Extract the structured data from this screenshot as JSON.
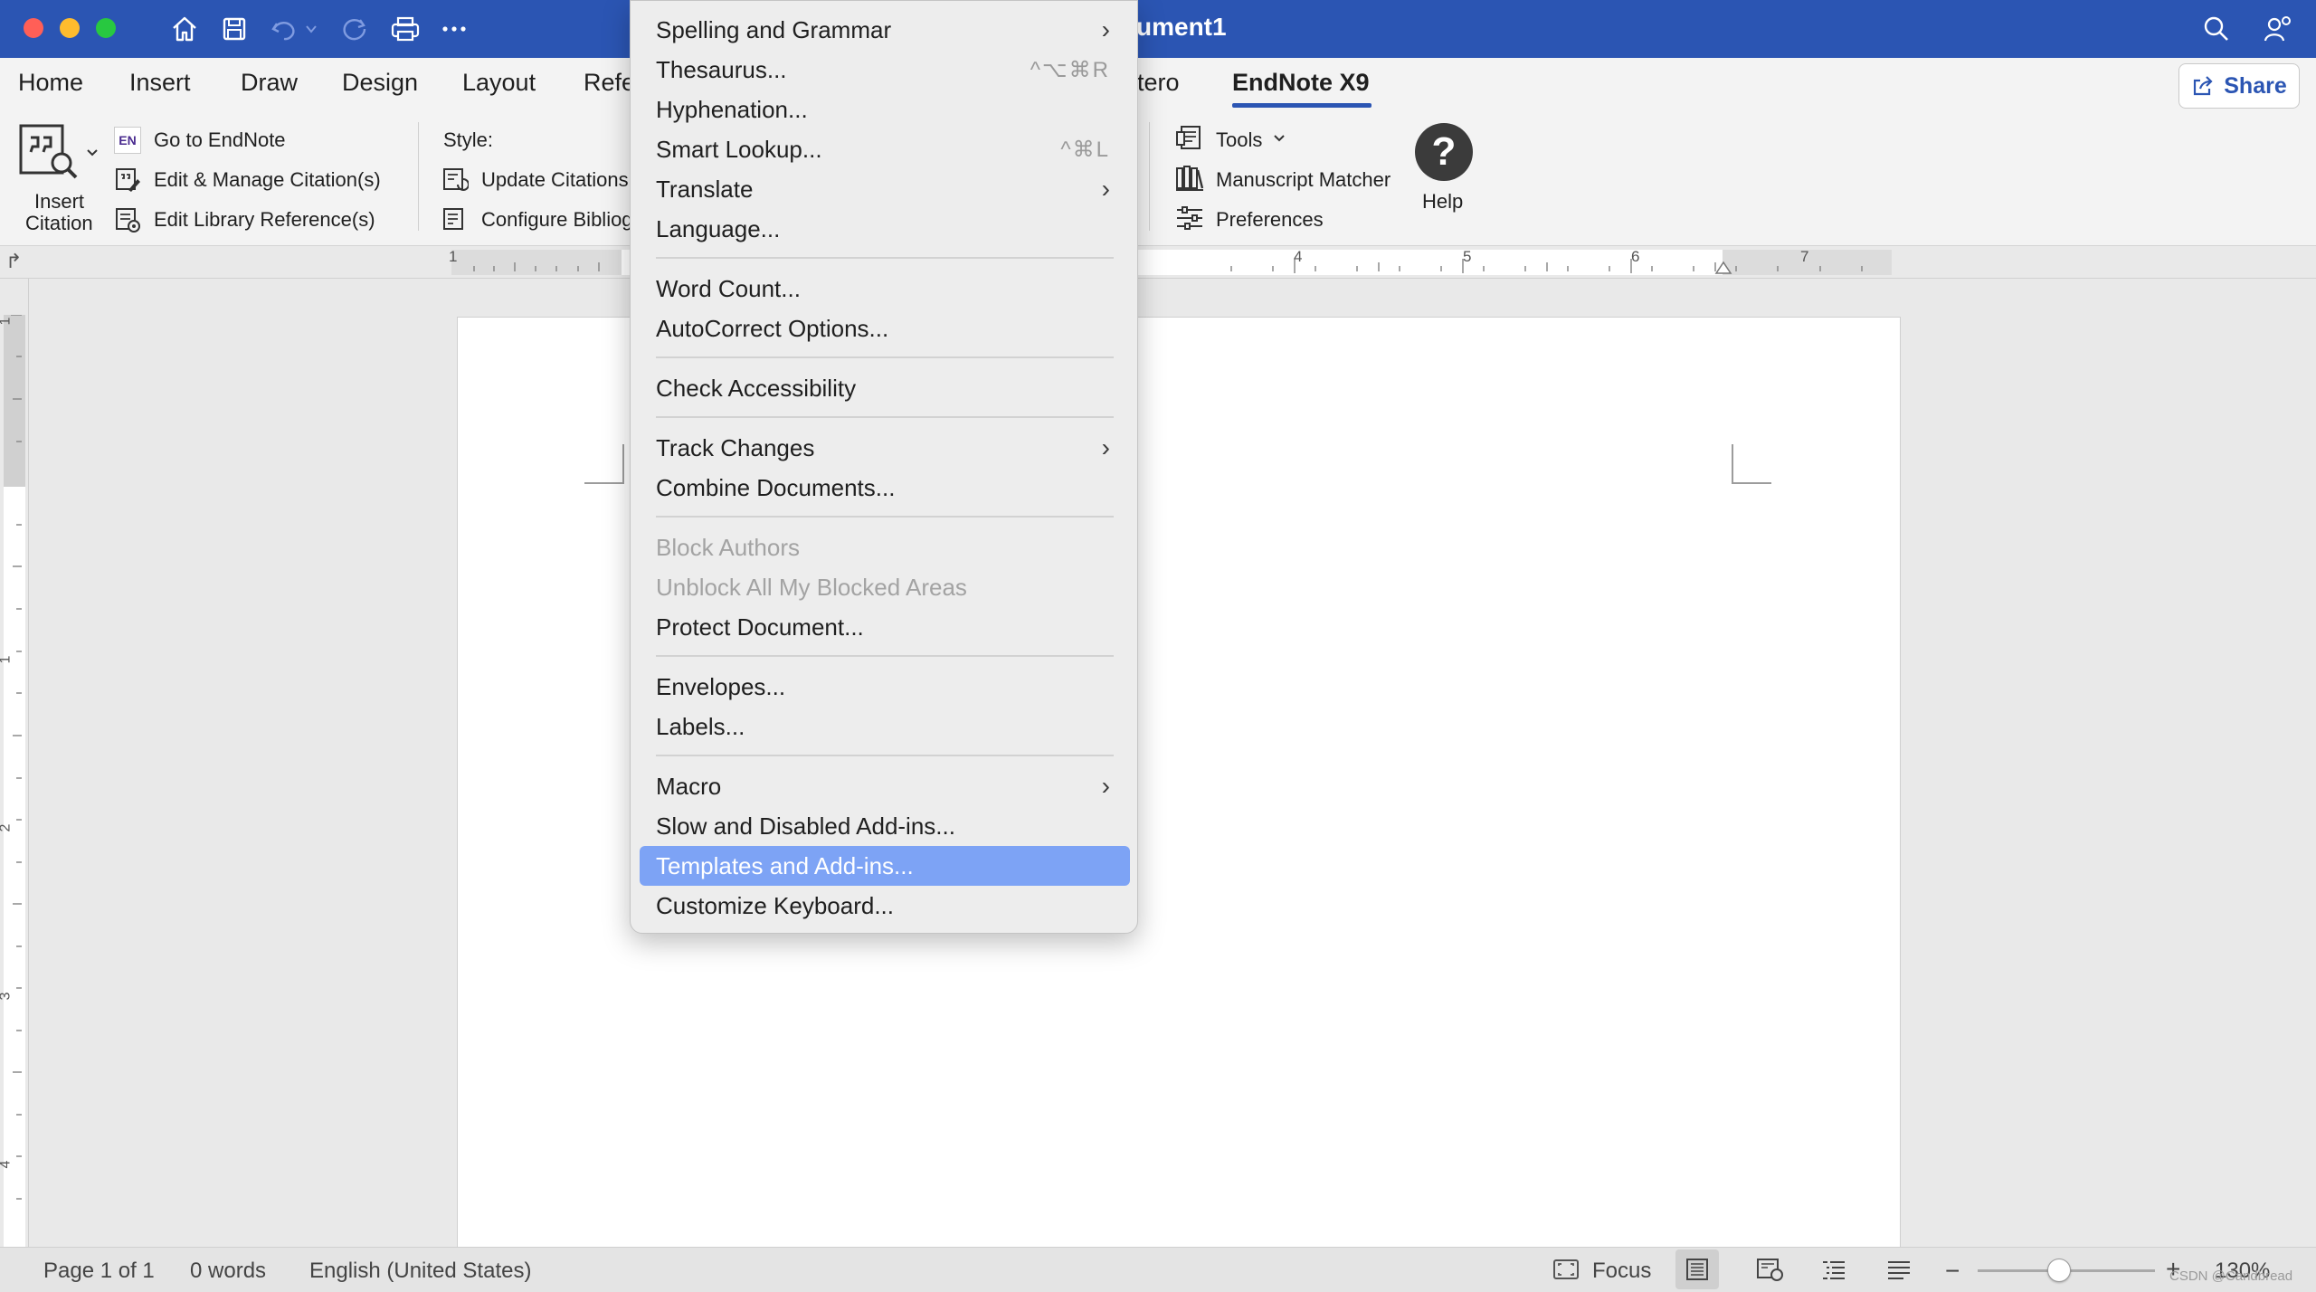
{
  "window": {
    "title": "ument1",
    "title_icons": [
      "home-icon",
      "save-icon",
      "undo-icon",
      "redo-icon",
      "print-icon",
      "more-icon"
    ],
    "right_icons": [
      "search-icon",
      "account-icon"
    ]
  },
  "tabs": {
    "items": [
      "Home",
      "Insert",
      "Draw",
      "Design",
      "Layout",
      "Refe",
      "otero",
      "EndNote X9"
    ],
    "active": "EndNote X9",
    "share_label": "Share"
  },
  "ribbon": {
    "insert_citation_line1": "Insert",
    "insert_citation_line2": "Citation",
    "go_to_endnote": "Go to EndNote",
    "endnote_badge": "EN",
    "edit_manage": "Edit & Manage Citation(s)",
    "edit_library": "Edit Library Reference(s)",
    "style_label": "Style:",
    "update_citations": "Update Citations",
    "configure_bib": "Configure Bibliog",
    "tools": "Tools",
    "manuscript_matcher": "Manuscript Matcher",
    "preferences": "Preferences",
    "help": "Help"
  },
  "ruler": {
    "h_numbers": [
      "1",
      "4",
      "5",
      "6",
      "7"
    ],
    "v_numbers": [
      "1",
      "1",
      "2",
      "3",
      "4"
    ]
  },
  "menu": {
    "items": [
      {
        "label": "Spelling and Grammar",
        "submenu": true,
        "shortcut": "",
        "disabled": false
      },
      {
        "label": "Thesaurus...",
        "submenu": false,
        "shortcut": "^⌥⌘R",
        "disabled": false
      },
      {
        "label": "Hyphenation...",
        "submenu": false,
        "shortcut": "",
        "disabled": false
      },
      {
        "label": "Smart Lookup...",
        "submenu": false,
        "shortcut": "^⌘L",
        "disabled": false
      },
      {
        "label": "Translate",
        "submenu": true,
        "shortcut": "",
        "disabled": false
      },
      {
        "label": "Language...",
        "submenu": false,
        "shortcut": "",
        "disabled": false
      },
      {
        "label": "Word Count...",
        "submenu": false,
        "shortcut": "",
        "disabled": false
      },
      {
        "label": "AutoCorrect Options...",
        "submenu": false,
        "shortcut": "",
        "disabled": false
      },
      {
        "label": "Check Accessibility",
        "submenu": false,
        "shortcut": "",
        "disabled": false
      },
      {
        "label": "Track Changes",
        "submenu": true,
        "shortcut": "",
        "disabled": false
      },
      {
        "label": "Combine Documents...",
        "submenu": false,
        "shortcut": "",
        "disabled": false
      },
      {
        "label": "Block Authors",
        "submenu": false,
        "shortcut": "",
        "disabled": true
      },
      {
        "label": "Unblock All My Blocked Areas",
        "submenu": false,
        "shortcut": "",
        "disabled": true
      },
      {
        "label": "Protect Document...",
        "submenu": false,
        "shortcut": "",
        "disabled": false
      },
      {
        "label": "Envelopes...",
        "submenu": false,
        "shortcut": "",
        "disabled": false
      },
      {
        "label": "Labels...",
        "submenu": false,
        "shortcut": "",
        "disabled": false
      },
      {
        "label": "Macro",
        "submenu": true,
        "shortcut": "",
        "disabled": false
      },
      {
        "label": "Slow and Disabled Add-ins...",
        "submenu": false,
        "shortcut": "",
        "disabled": false
      },
      {
        "label": "Templates and Add-ins...",
        "submenu": false,
        "shortcut": "",
        "disabled": false,
        "highlighted": true
      },
      {
        "label": "Customize Keyboard...",
        "submenu": false,
        "shortcut": "",
        "disabled": false
      }
    ]
  },
  "status": {
    "page": "Page 1 of 1",
    "words": "0 words",
    "language": "English (United States)",
    "focus": "Focus",
    "zoom": "130%",
    "zoom_level": 0.46,
    "watermark": "CSDN @Candbread"
  },
  "colors": {
    "titlebar": "#2b55b3",
    "menu_highlight": "#7da3f5",
    "menu_bg": "#ededed"
  }
}
